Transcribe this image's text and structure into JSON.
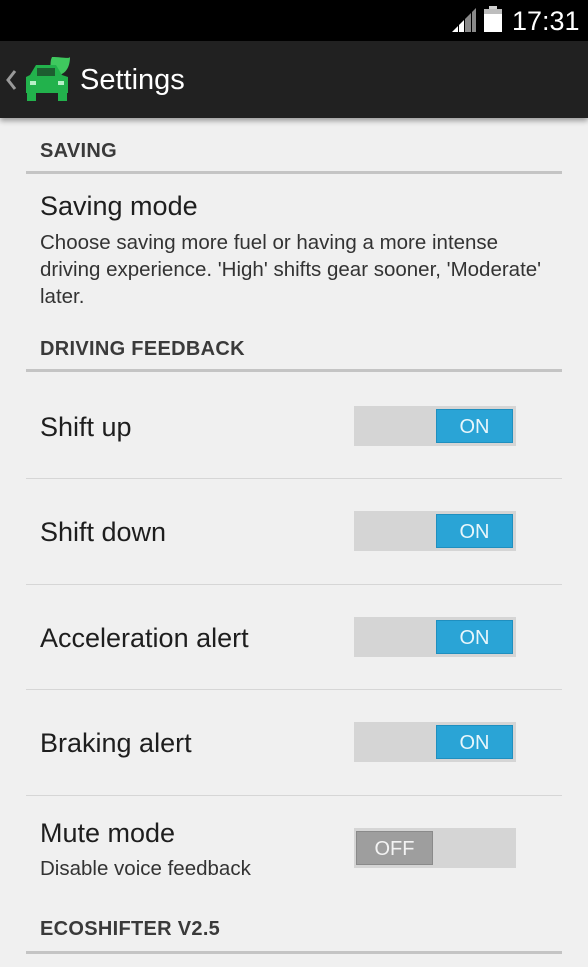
{
  "status_bar": {
    "time": "17:31",
    "signal_icon": "signal-icon",
    "battery_icon": "battery-icon"
  },
  "action_bar": {
    "title": "Settings",
    "up_icon": "chevron-left-icon",
    "app_icon": "car-leaf-icon",
    "app_icon_color": "#22b24c"
  },
  "sections": {
    "saving": {
      "header": "SAVING",
      "saving_mode": {
        "title": "Saving mode",
        "summary": "Choose saving more fuel or having a more intense driving experience. 'High' shifts gear sooner, 'Moderate' later."
      }
    },
    "driving_feedback": {
      "header": "DRIVING FEEDBACK",
      "shift_up": {
        "title": "Shift up",
        "switch_label": "ON",
        "on": true
      },
      "shift_down": {
        "title": "Shift down",
        "switch_label": "ON",
        "on": true
      },
      "acceleration_alert": {
        "title": "Acceleration alert",
        "switch_label": "ON",
        "on": true
      },
      "braking_alert": {
        "title": "Braking alert",
        "switch_label": "ON",
        "on": true
      },
      "mute_mode": {
        "title": "Mute mode",
        "summary": "Disable voice feedback",
        "switch_label": "OFF",
        "on": false
      }
    },
    "about": {
      "header": "ECOSHIFTER V2.5"
    }
  },
  "colors": {
    "switch_on": "#2aa4d6",
    "switch_off": "#9e9e9e",
    "background": "#f0f0f0",
    "action_bar": "#212121"
  }
}
